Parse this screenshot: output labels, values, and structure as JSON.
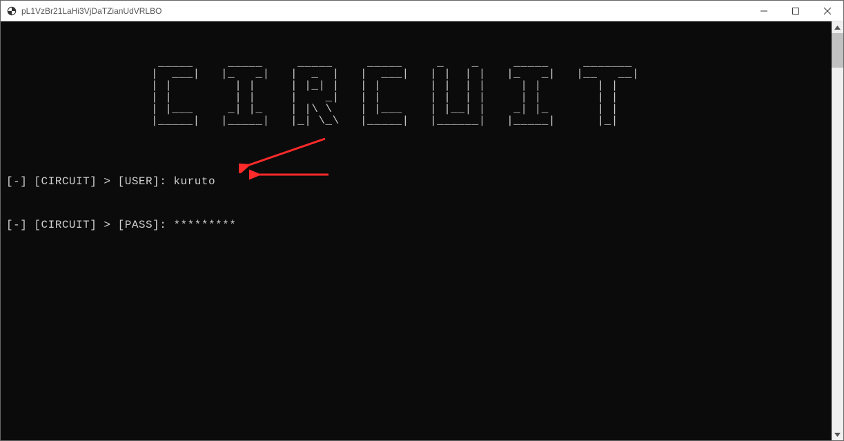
{
  "window": {
    "title": "pL1VzBr21LaHi3VjDaTZianUdVRLBO"
  },
  "terminal": {
    "ascii_banner": " _____     _____     _____     _____     _    _     _____     _______\n|  ___|   |_   _|   |  _  |   |  ___|   | |  | |   |_   _|   |__   __|\n| |         | |     | |_| |   | |       | |  | |     | |        | |\n| |         | |     |    _|   | |       | |  | |     | |        | |\n| |___     _| |_    | |\\ \\    | |___    | |__| |    _| |_       | |\n|_____|   |_____|   |_| \\_\\   |_____|   |______|   |_____|      |_|",
    "prompts": [
      {
        "prefix": "[-] [CIRCUIT] > [USER]: ",
        "value": "kuruto"
      },
      {
        "prefix": "[-] [CIRCUIT] > [PASS]: ",
        "value": "*********"
      }
    ]
  }
}
